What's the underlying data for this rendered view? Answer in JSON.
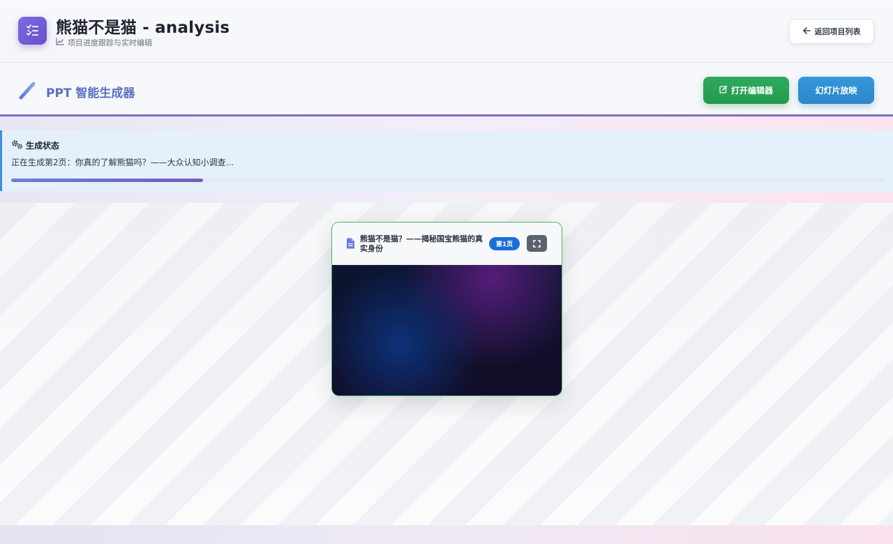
{
  "header": {
    "title": "熊猫不是猫 - analysis",
    "subtitle": "项目进度跟踪与实时编辑",
    "back_label": "返回项目列表",
    "app_icon": "tasks-icon"
  },
  "toolbar": {
    "title": "PPT 智能生成器",
    "editor_label": "打开编辑器",
    "slideshow_label": "幻灯片放映"
  },
  "status": {
    "title": "生成状态",
    "message": "正在生成第2页：你真的了解熊猫吗？——大众认知小调查...",
    "progress": 0.22
  },
  "slides": [
    {
      "title": "熊猫不是猫？——揭秘国宝熊猫的真实身份",
      "badge": "第1页"
    }
  ],
  "colors": {
    "accent": "#7d6bc8",
    "editor_button": "#28a455",
    "slideshow_button": "#3090d2",
    "badge": "#1a6fd8",
    "card_border": "#3cb86a"
  }
}
